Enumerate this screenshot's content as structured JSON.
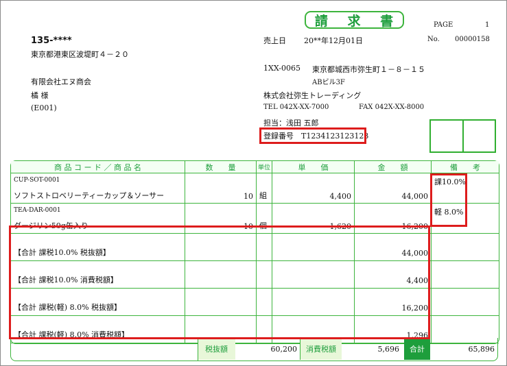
{
  "title": "請 求 書",
  "page": {
    "label": "PAGE",
    "value": "1"
  },
  "number": {
    "label": "No.",
    "value": "00000158"
  },
  "sales_date": {
    "label": "売上日",
    "value": "20**年12月01日"
  },
  "customer": {
    "zip": "135-****",
    "address": "東京都港東区波堤町４－２０",
    "company": "有限会社エヌ商会",
    "person": "橘 様",
    "code": "(E001)"
  },
  "issuer": {
    "zip": "1XX-0065",
    "address": "東京都城西市弥生町１－８－１５",
    "building": "ABビル3F",
    "company": "株式会社弥生トレーディング",
    "tel": "TEL 042X-XX-7000",
    "fax": "FAX 042X-XX-8000",
    "staff": "担当：浅田 五郎",
    "registration": "登録番号　T1234123123123"
  },
  "table": {
    "headers": [
      "商 品 コ ー ド ／ 商 品 名",
      "数　　量",
      "単位",
      "単　　価",
      "金　　額",
      "備　　考"
    ],
    "items": [
      {
        "code": "CUP-SOT-0001",
        "name": "ソフトストロベリーティーカップ＆ソーサー",
        "qty": "10",
        "unit": "組",
        "price": "4,400",
        "amount": "44,000",
        "note": "課10.0%"
      },
      {
        "code": "TEA-DAR-0001",
        "name": "ダージリン50g缶入り",
        "qty": "10",
        "unit": "個",
        "price": "1,620",
        "amount": "16,200",
        "note": "軽 8.0%"
      }
    ],
    "summaries": [
      {
        "label": "【合計 課税10.0% 税抜額】",
        "amount": "44,000"
      },
      {
        "label": "【合計 課税10.0% 消費税額】",
        "amount": "4,400"
      },
      {
        "label": "【合計 課税(軽) 8.0% 税抜額】",
        "amount": "16,200"
      },
      {
        "label": "【合計 課税(軽) 8.0% 消費税額】",
        "amount": "1,296"
      }
    ],
    "footer": {
      "subtotal_label": "税抜額",
      "subtotal": "60,200",
      "tax_label": "消費税額",
      "tax": "5,696",
      "total_label": "合計",
      "total": "65,896"
    }
  },
  "colors": {
    "accent_green": "#1e9e3c",
    "highlight_red": "#dd1c1c"
  }
}
